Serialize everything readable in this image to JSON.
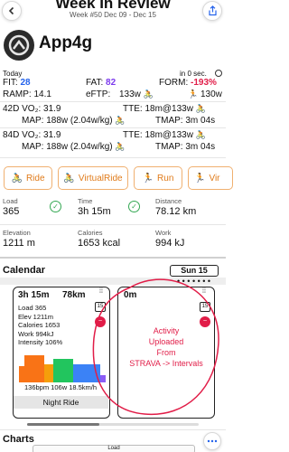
{
  "header": {
    "title": "Week In Review",
    "subtitle": "Week #50 Dec 09 - Dec 15"
  },
  "athlete": {
    "name": "App4g"
  },
  "today": {
    "label": "Today",
    "updated": "in 0 sec.",
    "fit_label": "FIT:",
    "fit_value": "28",
    "fat_label": "FAT:",
    "fat_value": "82",
    "form_label": "FORM:",
    "form_value": "-193%",
    "ramp_label": "RAMP:",
    "ramp_value": "14.1",
    "eftp_label": "eFTP:",
    "eftp_ride": "133w",
    "eftp_run": "130w"
  },
  "d42": {
    "label": "42D",
    "vo2_label": "VO₂:",
    "vo2": "31.9",
    "tte_label": "TTE:",
    "tte": "18m@133w",
    "map_label": "MAP:",
    "map": "188w (2.04w/kg)",
    "tmap_label": "TMAP:",
    "tmap": "3m 04s"
  },
  "d84": {
    "label": "84D",
    "vo2_label": "VO₂:",
    "vo2": "31.9",
    "tte_label": "TTE:",
    "tte": "18m@133w",
    "map_label": "MAP:",
    "map": "188w (2.04w/kg)",
    "tmap_label": "TMAP:",
    "tmap": "3m 04s"
  },
  "tabs": [
    "Ride",
    "VirtualRide",
    "Run",
    "Vir"
  ],
  "stats": {
    "load_label": "Load",
    "load": "365",
    "time_label": "Time",
    "time": "3h 15m",
    "distance_label": "Distance",
    "distance": "78.12 km",
    "elevation_label": "Elevation",
    "elevation": "1211 m",
    "calories_label": "Calories",
    "calories": "1653 kcal",
    "work_label": "Work",
    "work": "994 kJ"
  },
  "calendar": {
    "title": "Calendar",
    "day_label": "Sun 15",
    "card1": {
      "duration": "3h 15m",
      "distance": "78km",
      "lines": [
        "Load 365",
        "Elev 1211m",
        "Calories 1653",
        "Work 994kJ",
        "Intensity 106%"
      ],
      "bar_caption": "136bpm 106w 18.5km/h",
      "name": "Night Ride"
    },
    "card2": {
      "duration": "0m",
      "annotation": [
        "Activity",
        "Uploaded",
        "From",
        "STRAVA -> Intervals"
      ]
    }
  },
  "charts": {
    "title": "Charts",
    "bottom_label": "Load"
  },
  "colors": {
    "accent": "#e07b1a",
    "blue": "#2563eb",
    "red": "#e11d48",
    "green": "#34a853"
  }
}
